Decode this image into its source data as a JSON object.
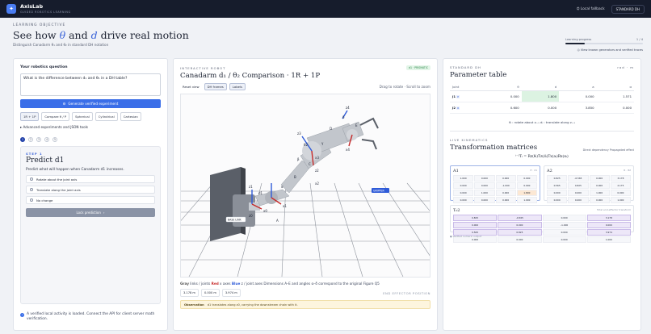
{
  "topbar": {
    "brand": "AxisLab",
    "tagline": "GUIDED ROBOTICS LEARNING",
    "fallback": "Local fallback",
    "mode": "STANDARD DH"
  },
  "hero": {
    "eyebrow": "LEARNING OBJECTIVE",
    "title_pre": "See how ",
    "theta": "θ",
    "title_mid": " and ",
    "d": "d",
    "title_post": " drive real motion",
    "subtitle": "Distinguish Canadarm θ₁ and θ₂ in standard DH notation",
    "progress_label": "Learning progress",
    "progress_value": "1 / 4",
    "progress_fraction": 0.25,
    "link": "View known generators and verified traces"
  },
  "left": {
    "question_label": "Your robotics question",
    "question": "What is the difference between d₁ and θ₁ in a DH table?",
    "generate": "Generate verified experiment",
    "chips": [
      "1R + 1P",
      "Compare θ / P",
      "Spherical",
      "Cylindrical",
      "Cartesian"
    ],
    "advanced": "Advanced experiments and JSON tools",
    "steps": [
      "1",
      "2",
      "3",
      "4",
      "5"
    ],
    "step_eyebrow": "STEP 1",
    "step_title": "Predict d1",
    "step_desc": "Predict what will happen when Canadarm d1 increases.",
    "options": [
      "Rotate about the joint axis",
      "Translate along the joint axis",
      "No change"
    ],
    "lock": "Lock prediction",
    "note": "A verified local activity is loaded. Connect the API for client server math verification."
  },
  "middle": {
    "eyebrow": "INTERACTIVE ROBOT",
    "badge": "d1 · PRISMATIC",
    "title": "Canadarm d₁ / θ₂ Comparison · 1R + 1P",
    "tabs": [
      "Reset view",
      "DH frames",
      "Labels"
    ],
    "hint": "Drag to rotate · Scroll to zoom",
    "legend_gray": "Gray",
    "legend_gray_t": " links / joints   ",
    "legend_red": "Red",
    "legend_red_t": " x axes   ",
    "legend_blue": "Blue",
    "legend_blue_t": " z / joint axes   Dimensions A–E and angles α–δ correspond to the original Figure Q5",
    "coords": [
      "3.178 m",
      "0.000 m",
      "3.974 m"
    ],
    "ee": "END EFFECTOR POSITION",
    "obs_label": "Observation",
    "obs_text": "d1 translates along z0, carrying the downstream chain with it.",
    "labels": [
      "z1",
      "z2",
      "x2",
      "z0",
      "x0",
      "x1",
      "z3",
      "x3",
      "z4",
      "x4",
      "d1",
      "θ2",
      "GRIPPER",
      "BASE LINK",
      "A",
      "B",
      "C",
      "D",
      "E",
      "α",
      "β",
      "γ",
      "δ"
    ]
  },
  "right": {
    "eyebrow": "STANDARD DH",
    "units": "rad · m",
    "title": "Parameter table",
    "headers": [
      "Joint",
      "θ",
      "d",
      "a",
      "α"
    ],
    "rows": [
      [
        "J1",
        "P",
        "0.000",
        "1.800",
        "0.000",
        "1.571"
      ],
      [
        "J2",
        "R",
        "0.600",
        "0.000",
        "3.850",
        "0.000"
      ]
    ],
    "legend_theta": "θᵢ : rotate about zᵢ₋₁",
    "legend_d": "dᵢ : translate along zᵢ₋₁",
    "tf_eyebrow": "LIVE KINEMATICS",
    "tf_title": "Transformation matrices",
    "tf_right": "Direct dependency  Propagated effect",
    "formula": "ⁱ⁻¹Tᵢ = Rz(θᵢ)Tz(dᵢ)Tx(aᵢ)Rx(αᵢ)",
    "A1_name": "A1",
    "A1_tag": "P · d1",
    "A1": [
      "1.000",
      "0.000",
      "0.000",
      "0.000",
      "0.000",
      "0.000",
      "-1.000",
      "0.000",
      "0.000",
      "1.000",
      "0.000",
      "1.800",
      "0.000",
      "0.000",
      "0.000",
      "1.000"
    ],
    "A2_name": "A2",
    "A2_tag": "R · θ2",
    "A2": [
      "0.825",
      "-0.565",
      "0.000",
      "3.178",
      "0.565",
      "0.825",
      "0.000",
      "2.175",
      "0.000",
      "0.000",
      "1.000",
      "0.000",
      "0.000",
      "0.000",
      "0.000",
      "1.000"
    ],
    "T_name": "T₀2",
    "T_tag": "Total end-effector transform",
    "T": [
      "0.825",
      "-0.565",
      "0.000",
      "3.178",
      "0.000",
      "0.000",
      "-1.000",
      "0.000",
      "0.565",
      "0.825",
      "0.000",
      "3.974",
      "0.000",
      "0.000",
      "0.000",
      "1.000"
    ],
    "foot": "● Verified numeric output"
  }
}
